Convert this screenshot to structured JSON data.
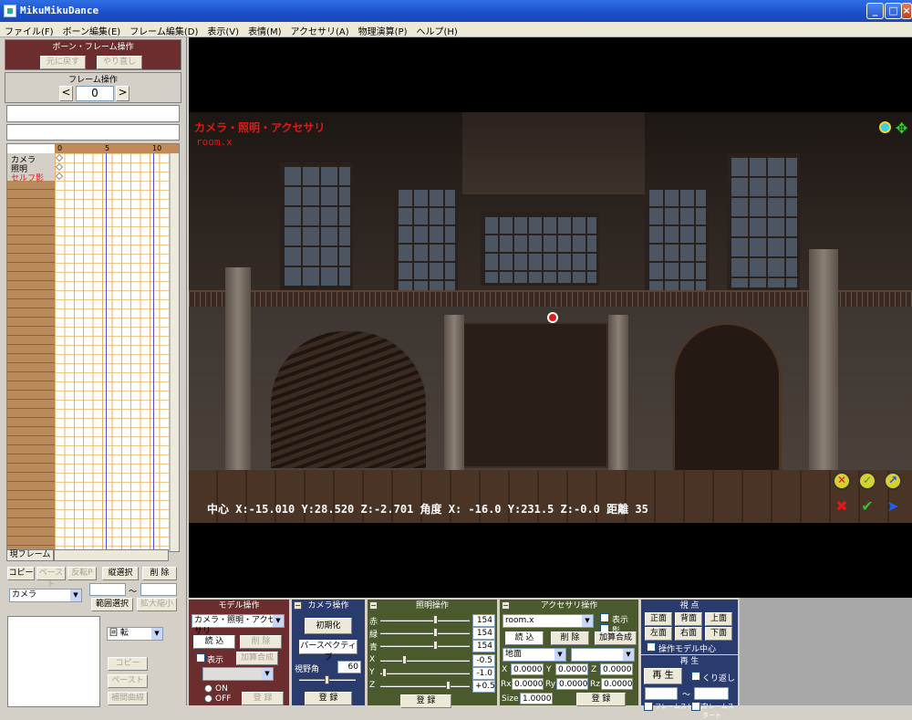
{
  "window": {
    "title": "MikuMikuDance",
    "min_icon": "minimize-icon",
    "max_icon": "maximize-icon",
    "close_icon": "close-icon"
  },
  "menu": [
    "ファイル(F)",
    "ボーン編集(E)",
    "フレーム編集(D)",
    "表示(V)",
    "表情(M)",
    "アクセサリ(A)",
    "物理演算(P)",
    "ヘルプ(H)"
  ],
  "bone_frame": {
    "title": "ボーン・フレーム操作",
    "undo": "元に戻す",
    "redo": "やり直し"
  },
  "frame_ops": {
    "title": "フレーム操作",
    "prev": "<",
    "next": ">",
    "value": "0"
  },
  "timeline": {
    "ticks": [
      "0",
      "5",
      "10"
    ],
    "tracks": [
      "カメラ",
      "照明",
      "セルフ影"
    ],
    "current_frame_label": "現フレーム"
  },
  "edit_buttons": {
    "copy": "コピー",
    "paste": "ペースト",
    "reverse_paste": "反転P",
    "vertical_select": "縦選択",
    "delete": "削 除"
  },
  "target_select": {
    "value": "カメラ"
  },
  "range": {
    "tilde": "〜",
    "range_select": "範囲選択",
    "scale": "拡大縮小"
  },
  "bone_side": {
    "rotate": "回 転",
    "copy": "コピー",
    "paste": "ペースト",
    "interp": "補間曲線"
  },
  "overlay": {
    "header": "カメラ・照明・アクセサリ",
    "model": "room.x",
    "status": "中心 X:-15.010 Y:28.520 Z:-2.701  角度 X: -16.0 Y:231.5 Z:-0.0  距離 35"
  },
  "model_panel": {
    "title": "モデル操作",
    "select": "カメラ・照明・アクセサリ",
    "load": "読 込",
    "delete": "削 除",
    "show": "表示",
    "add_comp": "加算合成",
    "on": "ON",
    "off": "OFF",
    "register": "登 録"
  },
  "camera_panel": {
    "title": "カメラ操作",
    "init": "初期化",
    "perspective": "パースペクティブ",
    "fov_label": "視野角",
    "fov": "60",
    "register": "登 録"
  },
  "light_panel": {
    "title": "照明操作",
    "r_label": "赤",
    "g_label": "緑",
    "b_label": "青",
    "r": "154",
    "g": "154",
    "b": "154",
    "x_label": "X",
    "y_label": "Y",
    "z_label": "Z",
    "x": "-0.5",
    "y": "-1.0",
    "z": "+0.5",
    "register": "登 録"
  },
  "acc_panel": {
    "title": "アクセサリ操作",
    "select": "room.x",
    "show": "表示",
    "shadow": "影",
    "load": "読 込",
    "delete": "削 除",
    "add_comp": "加算合成",
    "attach": "地面",
    "x_label": "X",
    "y_label": "Y",
    "z_label": "Z",
    "rx_label": "Rx",
    "ry_label": "Ry",
    "rz_label": "Rz",
    "x": "0.0000",
    "y": "0.0000",
    "z": "0.0000",
    "rx": "0.0000",
    "ry": "0.0000",
    "rz": "0.0000",
    "size_label": "Size",
    "size": "1.0000",
    "register": "登 録"
  },
  "view_panel": {
    "title": "視 点",
    "front": "正面",
    "back": "背面",
    "top": "上面",
    "left": "左面",
    "right": "右面",
    "bottom": "下面",
    "op_center": "操作モデル中心"
  },
  "play_panel": {
    "title": "再 生",
    "play": "再 生",
    "repeat": "くり返し",
    "frame_stop": "フレームストップ",
    "frame_start": "フレームスタート"
  },
  "colors": {
    "bone_panel": "#6b2d2d",
    "model_panel": "#6b2d2d",
    "camera_panel": "#2a3b6e",
    "light_panel": "#4a5a2c",
    "acc_panel": "#4a5a2c",
    "view_panel": "#2a3b6e",
    "overlay_red": "#e01818"
  }
}
